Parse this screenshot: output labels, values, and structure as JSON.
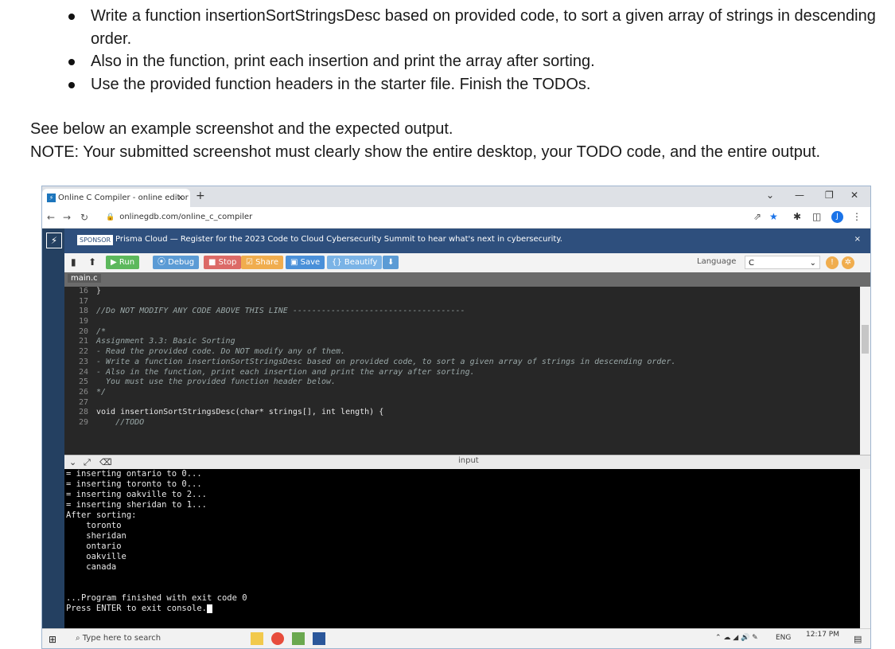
{
  "doc": {
    "bullets": [
      "Write a function insertionSortStringsDesc based on provided code, to sort a given array of strings in descending order.",
      "Also in the function, print each insertion and print the array after sorting.",
      "Use the provided function headers in the starter file. Finish the TODOs."
    ],
    "see_below": "See below an example screenshot and the expected output.",
    "note": "NOTE: Your submitted screenshot must clearly show the entire desktop, your TODO code, and the entire output."
  },
  "browser": {
    "tab_title": "Online C Compiler - online editor",
    "tab_close": "×",
    "new_tab": "+",
    "url": "onlinegdb.com/online_c_compiler",
    "avatar": "J",
    "window_controls": [
      "⌄",
      "—",
      "❐",
      "✕"
    ]
  },
  "banner": {
    "sponsor": "SPONSOR",
    "text": "Prisma Cloud — Register for the 2023 Code to Cloud Cybersecurity Summit to hear what's next in cybersecurity.",
    "close": "×"
  },
  "toolbar": {
    "run": "▶ Run",
    "debug": "⦿ Debug",
    "stop": "■ Stop",
    "share": "☑ Share",
    "save": "▣ Save",
    "beautify": "{} Beautify",
    "language_label": "Language",
    "language_value": "C"
  },
  "file_tab": "main.c",
  "editor": {
    "lines": [
      {
        "n": "16",
        "text": "}",
        "type": "code"
      },
      {
        "n": "17",
        "text": "",
        "type": "code"
      },
      {
        "n": "18",
        "text": "//Do NOT MODIFY ANY CODE ABOVE THIS LINE ------------------------------------",
        "type": "cm"
      },
      {
        "n": "19",
        "text": "",
        "type": "code"
      },
      {
        "n": "20",
        "text": "/*",
        "type": "cm"
      },
      {
        "n": "21",
        "text": "Assignment 3.3: Basic Sorting",
        "type": "cm"
      },
      {
        "n": "22",
        "text": "- Read the provided code. Do NOT modify any of them.",
        "type": "cm"
      },
      {
        "n": "23",
        "text": "- Write a function insertionSortStringsDesc based on provided code, to sort a given array of strings in descending order.",
        "type": "cm"
      },
      {
        "n": "24",
        "text": "- Also in the function, print each insertion and print the array after sorting.",
        "type": "cm"
      },
      {
        "n": "25",
        "text": "  You must use the provided function header below.",
        "type": "cm"
      },
      {
        "n": "26",
        "text": "*/",
        "type": "cm"
      },
      {
        "n": "27",
        "text": "",
        "type": "code"
      },
      {
        "n": "28",
        "text": "void insertionSortStringsDesc(char* strings[], int length) {",
        "type": "kw"
      },
      {
        "n": "29",
        "text": "    //TODO",
        "type": "cm"
      }
    ]
  },
  "console_bar": {
    "input_label": "input"
  },
  "console": {
    "lines": [
      "= inserting ontario to 0...",
      "= inserting toronto to 0...",
      "= inserting oakville to 2...",
      "= inserting sheridan to 1...",
      "After sorting:",
      "    toronto",
      "    sheridan",
      "    ontario",
      "    oakville",
      "    canada",
      "",
      "",
      "...Program finished with exit code 0",
      "Press ENTER to exit console."
    ]
  },
  "taskbar": {
    "search_placeholder": "Type here to search",
    "lang": "ENG",
    "time": "12:17 PM"
  }
}
